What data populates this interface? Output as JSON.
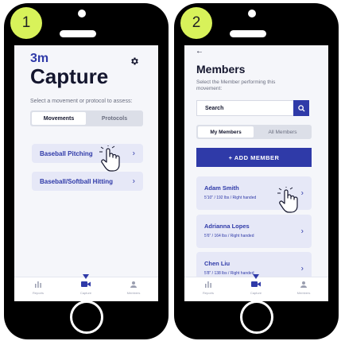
{
  "colors": {
    "accent": "#2f3aa8",
    "badge": "#d8f25a",
    "card": "#e6e8f7",
    "screen_bg": "#f5f6fa"
  },
  "phone1": {
    "step": "1",
    "logo": "3m",
    "settings_icon": "gear-icon",
    "title": "Capture",
    "subtitle": "Select a movement or protocol to assess:",
    "tabs": [
      {
        "label": "Movements",
        "active": true
      },
      {
        "label": "Protocols",
        "active": false
      }
    ],
    "cards": [
      {
        "label": "Baseball Pitching"
      },
      {
        "label": "Baseball/Softball Hitting"
      }
    ],
    "nav": [
      {
        "label": "Reports",
        "icon": "bar-chart-icon"
      },
      {
        "label": "Capture",
        "icon": "video-camera-icon",
        "active": true
      },
      {
        "label": "Members",
        "icon": "members-icon"
      }
    ]
  },
  "phone2": {
    "step": "2",
    "back": "←",
    "title": "Members",
    "subtitle": "Select the Member performing this movement:",
    "search_placeholder": "Search",
    "tabs": [
      {
        "label": "My Members",
        "active": true
      },
      {
        "label": "All Members",
        "active": false
      }
    ],
    "add_button": "+ ADD MEMBER",
    "members": [
      {
        "name": "Adam Smith",
        "meta": "5'10\" / 192 lbs / Right handed"
      },
      {
        "name": "Adrianna Lopes",
        "meta": "5'6\" / 164 lbs / Right handed"
      },
      {
        "name": "Chen Liu",
        "meta": "5'8\" / 138 lbs / Right handed"
      }
    ],
    "nav": [
      {
        "label": "Reports",
        "icon": "bar-chart-icon"
      },
      {
        "label": "Capture",
        "icon": "video-camera-icon",
        "active": true
      },
      {
        "label": "Members",
        "icon": "members-icon"
      }
    ]
  }
}
